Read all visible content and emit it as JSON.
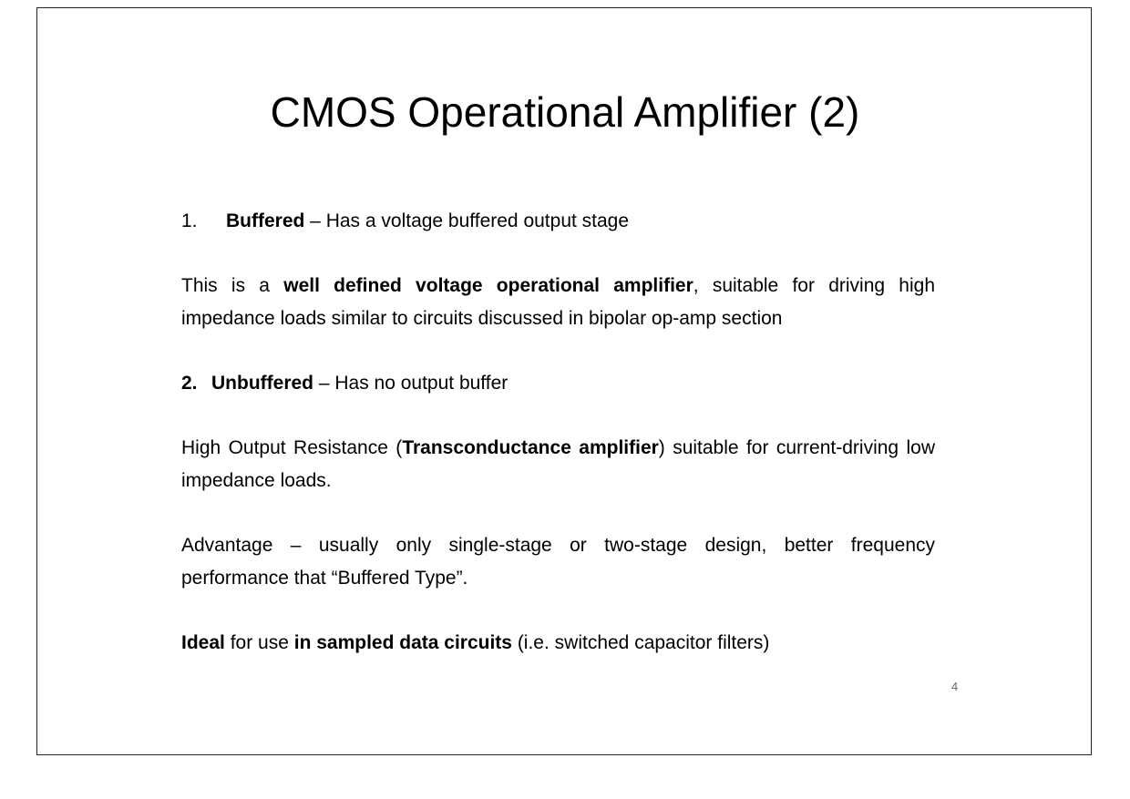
{
  "slide": {
    "title": "CMOS Operational Amplifier (2)",
    "item1": {
      "number": "1.",
      "term": "Buffered",
      "rest": " – Has a voltage buffered output stage"
    },
    "para1": {
      "pre": "This is a ",
      "bold": "well defined voltage operational amplifier",
      "post": ", suitable for driving high impedance loads similar to circuits discussed in bipolar op-amp section"
    },
    "item2": {
      "number": "2.",
      "term": "Unbuffered",
      "rest": " – Has no output buffer"
    },
    "para2": {
      "pre": "High Output Resistance (",
      "bold": "Transconductance amplifier",
      "post": ") suitable for current-driving low impedance loads."
    },
    "para3": {
      "text": "Advantage – usually only single-stage or two-stage design, better frequency performance that “Buffered Type”."
    },
    "para4": {
      "bold1": "Ideal",
      "mid": " for use ",
      "bold2": "in sampled data circuits",
      "post": " (i.e. switched capacitor filters)"
    },
    "page_number": "4"
  }
}
